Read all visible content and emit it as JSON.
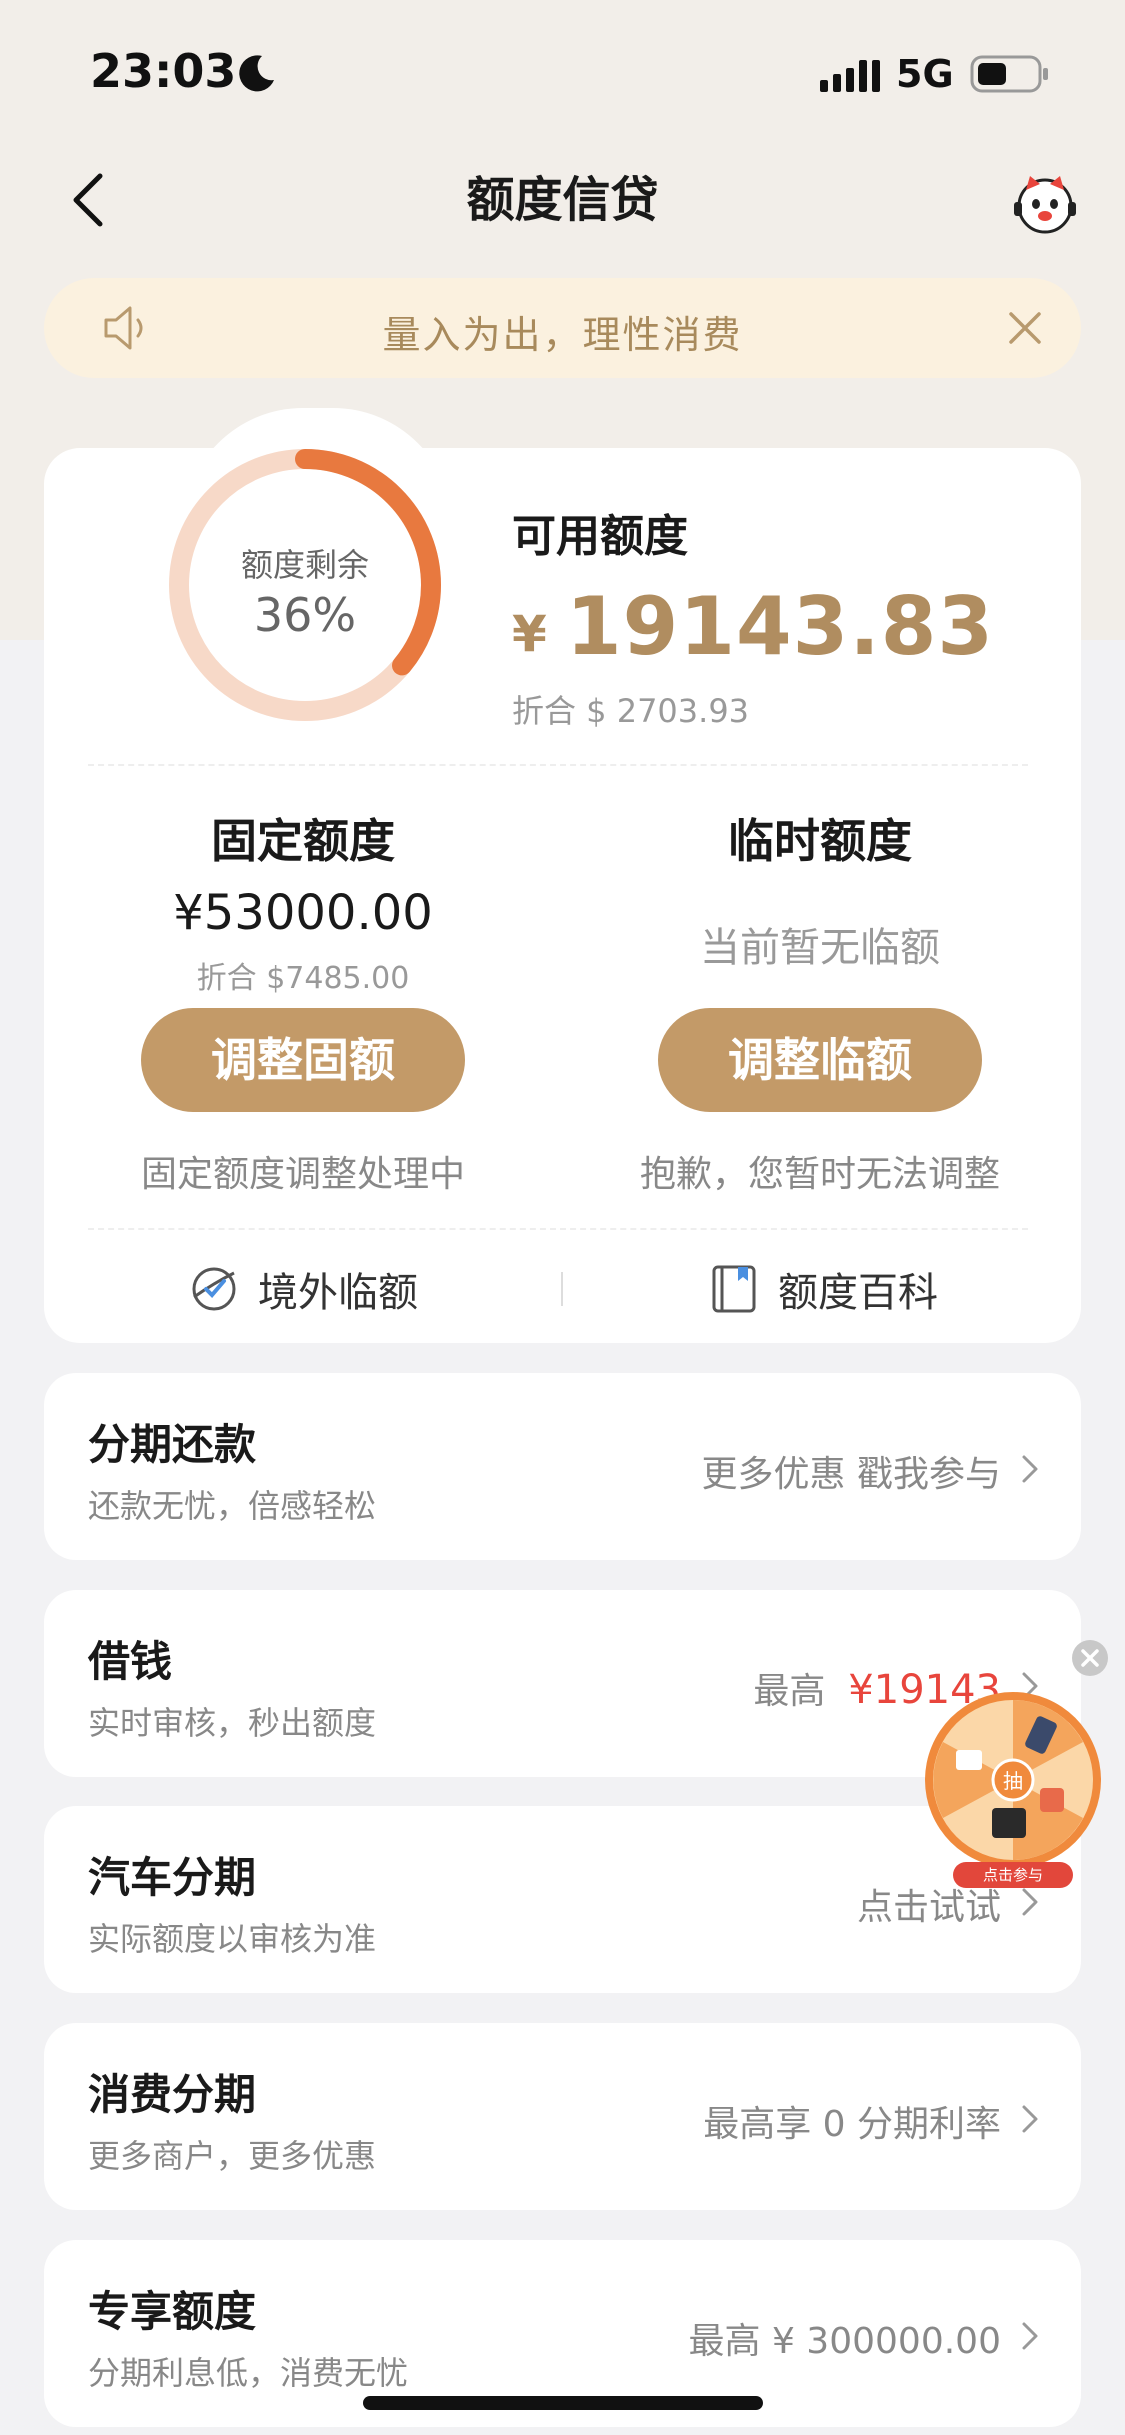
{
  "status_bar": {
    "time": "23:03",
    "network": "5G"
  },
  "nav": {
    "title": "额度信贷"
  },
  "notice": {
    "text": "量入为出，理性消费"
  },
  "credit": {
    "ring_label": "额度剩余",
    "ring_percent": "36%",
    "ring_fraction": 0.36,
    "available_label": "可用额度",
    "available_currency": "¥",
    "available_amount": "19143.83",
    "available_usd": "折合 $ 2703.93",
    "fixed": {
      "title": "固定额度",
      "amount": "¥53000.00",
      "usd": "折合 $7485.00",
      "button": "调整固额",
      "note": "固定额度调整处理中"
    },
    "temporary": {
      "title": "临时额度",
      "status": "当前暂无临额",
      "button": "调整临额",
      "note": "抱歉，您暂时无法调整"
    },
    "quick_links": [
      {
        "label": "境外临额",
        "icon": "overseas-quota-icon"
      },
      {
        "label": "额度百科",
        "icon": "book-icon"
      }
    ]
  },
  "rows": [
    {
      "title": "分期还款",
      "subtitle": "还款无忧，倍感轻松",
      "right": "更多优惠 戳我参与"
    },
    {
      "title": "借钱",
      "subtitle": "实时审核，秒出额度",
      "right_prefix": "最高",
      "right_highlight": "¥19143"
    },
    {
      "title": "汽车分期",
      "subtitle": "实际额度以审核为准",
      "right": "点击试试"
    },
    {
      "title": "消费分期",
      "subtitle": "更多商户，更多优惠",
      "right": "最高享 0 分期利率"
    },
    {
      "title": "专享额度",
      "subtitle": "分期利息低，消费无忧",
      "right": "最高 ¥ 300000.00"
    }
  ],
  "lottery_widget": {
    "center": "抽",
    "label": "点击参与"
  },
  "colors": {
    "accent_gold": "#c39a68",
    "ring_orange": "#e8793f",
    "ring_track": "#f7d9c8",
    "highlight_red": "#e8453c"
  }
}
